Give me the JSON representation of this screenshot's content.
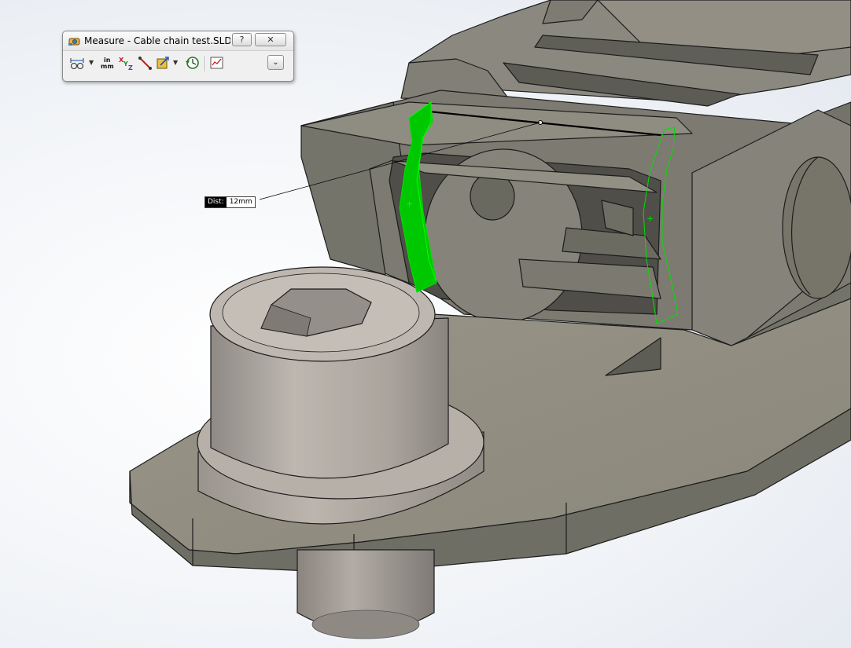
{
  "measure_dialog": {
    "title": "Measure - Cable chain test.SLDA...",
    "help_label": "?",
    "close_label": "✕",
    "units_top": "in",
    "units_bottom": "mm",
    "expand_label": "⌄",
    "tools": [
      {
        "name": "arc-circle-measurements-icon"
      },
      {
        "name": "units-precision-icon"
      },
      {
        "name": "show-xyz-measurements-icon"
      },
      {
        "name": "point-to-point-icon"
      },
      {
        "name": "projected-on-icon"
      },
      {
        "name": "measurement-history-icon"
      },
      {
        "name": "create-sensor-icon"
      }
    ]
  },
  "dist_callout": {
    "label": "Dist:",
    "value": "12mm"
  },
  "colors": {
    "part_top": "#8f8d82",
    "part_side": "#6b6a61",
    "part_dark": "#56554e",
    "bolt_light": "#b4aea7",
    "selection_green": "#00cc00",
    "background": "#ffffff"
  }
}
